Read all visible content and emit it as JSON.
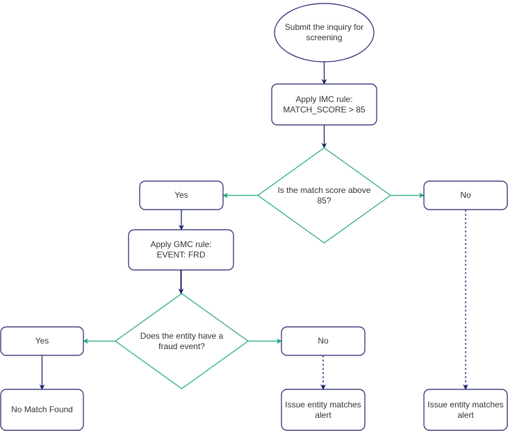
{
  "diagram": {
    "type": "flowchart",
    "colors": {
      "process_stroke": "#1b1f6b",
      "decision_stroke": "#1fa77b",
      "text": "#333333",
      "background": "#ffffff"
    },
    "nodes": [
      {
        "id": "start",
        "shape": "ellipse",
        "label": "Submit the inquiry for\nscreening"
      },
      {
        "id": "imc_rule",
        "shape": "process",
        "label": "Apply IMC rule:\nMATCH_SCORE > 85"
      },
      {
        "id": "decision_score",
        "shape": "decision",
        "label": "Is the match score above\n85?"
      },
      {
        "id": "yes_1",
        "shape": "process",
        "label": "Yes"
      },
      {
        "id": "no_1",
        "shape": "process",
        "label": "No"
      },
      {
        "id": "gmc_rule",
        "shape": "process",
        "label": "Apply GMC rule:\nEVENT: FRD"
      },
      {
        "id": "decision_fraud",
        "shape": "decision",
        "label": "Does the entity have a\nfraud event?"
      },
      {
        "id": "yes_2",
        "shape": "process",
        "label": "Yes"
      },
      {
        "id": "no_2",
        "shape": "process",
        "label": "No"
      },
      {
        "id": "no_match",
        "shape": "process",
        "label": "No Match Found"
      },
      {
        "id": "alert_1",
        "shape": "process",
        "label": "Issue entity matches\nalert"
      },
      {
        "id": "alert_2",
        "shape": "process",
        "label": "Issue entity matches\nalert"
      }
    ],
    "edges": [
      {
        "from": "start",
        "to": "imc_rule",
        "style": "solid",
        "color": "process"
      },
      {
        "from": "imc_rule",
        "to": "decision_score",
        "style": "solid",
        "color": "process"
      },
      {
        "from": "decision_score",
        "to": "yes_1",
        "style": "solid",
        "color": "decision"
      },
      {
        "from": "decision_score",
        "to": "no_1",
        "style": "solid",
        "color": "decision"
      },
      {
        "from": "yes_1",
        "to": "gmc_rule",
        "style": "solid",
        "color": "process"
      },
      {
        "from": "gmc_rule",
        "to": "decision_fraud",
        "style": "solid",
        "color": "process"
      },
      {
        "from": "decision_fraud",
        "to": "yes_2",
        "style": "solid",
        "color": "decision"
      },
      {
        "from": "decision_fraud",
        "to": "no_2",
        "style": "solid",
        "color": "decision"
      },
      {
        "from": "yes_2",
        "to": "no_match",
        "style": "solid",
        "color": "process"
      },
      {
        "from": "no_2",
        "to": "alert_1",
        "style": "dashed",
        "color": "process"
      },
      {
        "from": "no_1",
        "to": "alert_2",
        "style": "dashed",
        "color": "process"
      }
    ]
  }
}
